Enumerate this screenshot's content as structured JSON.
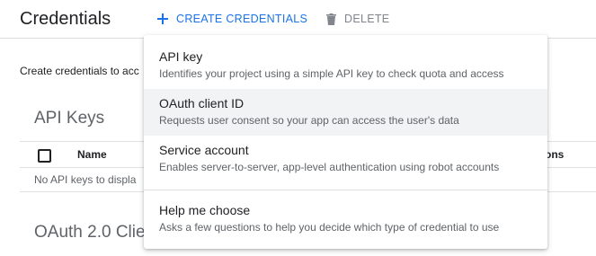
{
  "header": {
    "title": "Credentials",
    "create_label": "CREATE CREDENTIALS",
    "delete_label": "DELETE"
  },
  "main": {
    "intro_text": "Create credentials to acc",
    "api_keys": {
      "title": "API Keys",
      "columns": {
        "name": "Name",
        "actions": "ons"
      },
      "empty_message": "No API keys to displa"
    },
    "oauth": {
      "title": "OAuth 2.0 Clie"
    }
  },
  "menu": {
    "items": [
      {
        "label": "API key",
        "description": "Identifies your project using a simple API key to check quota and access"
      },
      {
        "label": "OAuth client ID",
        "description": "Requests user consent so your app can access the user's data"
      },
      {
        "label": "Service account",
        "description": "Enables server-to-server, app-level authentication using robot accounts"
      },
      {
        "label": "Help me choose",
        "description": "Asks a few questions to help you decide which type of credential to use"
      }
    ]
  },
  "colors": {
    "accent": "#1a73e8",
    "text_primary": "#202124",
    "text_secondary": "#5f6368",
    "hover_background": "#f1f3f4"
  },
  "icons": {
    "create": "plus-icon",
    "delete": "trash-icon"
  }
}
